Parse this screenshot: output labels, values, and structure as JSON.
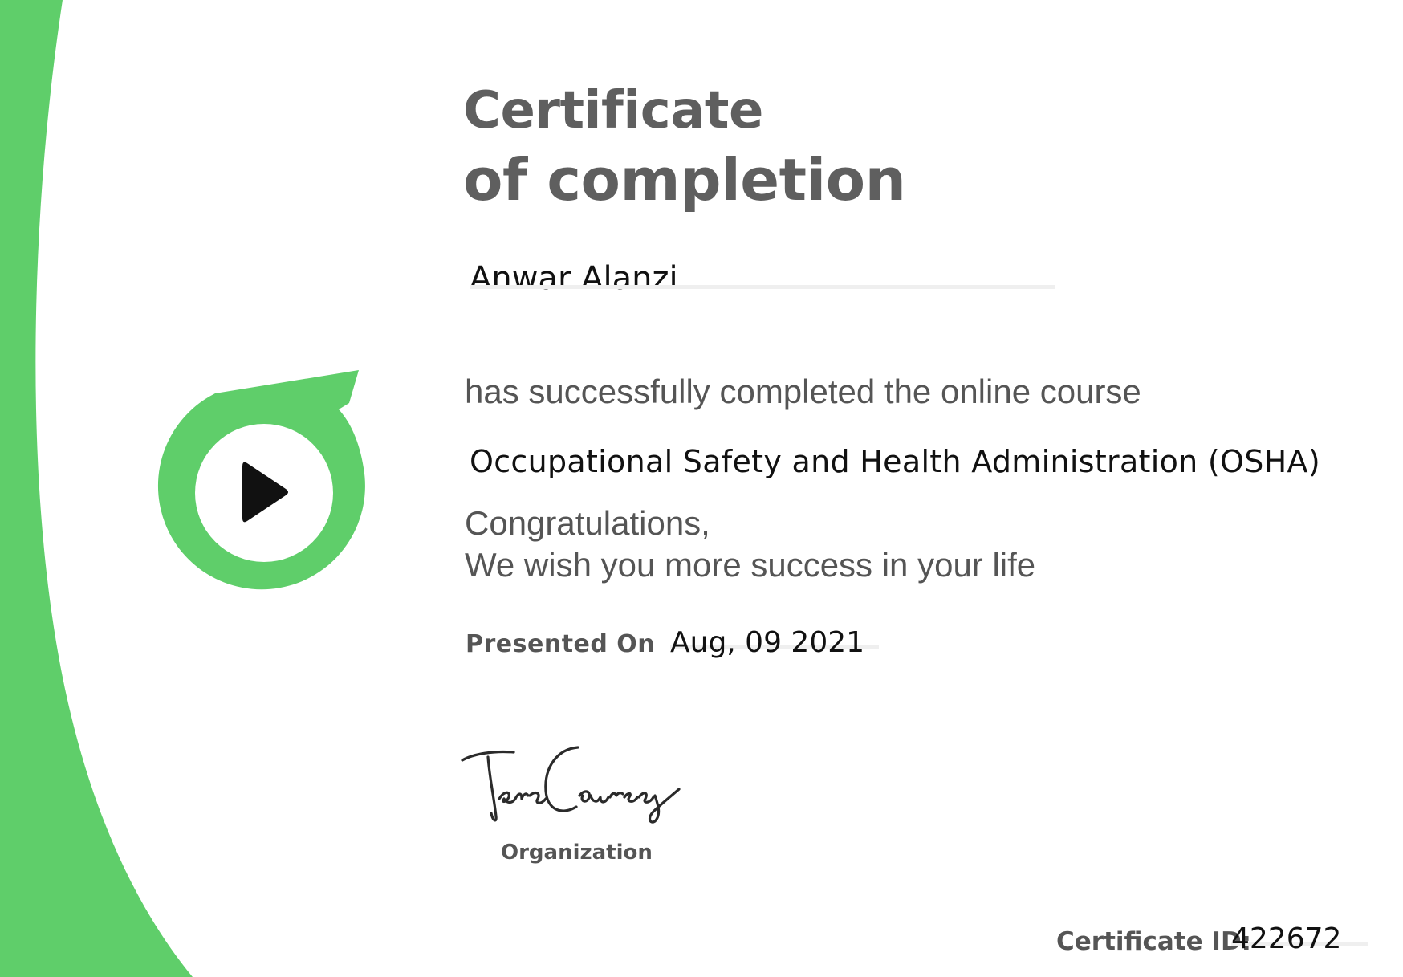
{
  "colors": {
    "brand_green": "#5fce6a",
    "title_gray": "#5f5f5f",
    "body_gray": "#555555",
    "ink": "#111111"
  },
  "certificate": {
    "title_line1": "Certificate",
    "title_line2": "of completion",
    "recipient_name": "Anwar Alanzi",
    "intro_text": "has successfully completed the online course",
    "course_name": "Occupational Safety and Health Administration (OSHA)",
    "congrats_line1": "Congratulations,",
    "congrats_line2": "We wish you more success in your life",
    "presented_label": "Presented On",
    "presented_date": "Aug, 09 2021",
    "signature_text": "TeraCourses",
    "organization_label": "Organization",
    "certificate_id_label": "Certificate ID:",
    "certificate_id_value": "422672"
  },
  "icons": {
    "logo": "play-ring-logo-icon",
    "play": "play-icon"
  }
}
